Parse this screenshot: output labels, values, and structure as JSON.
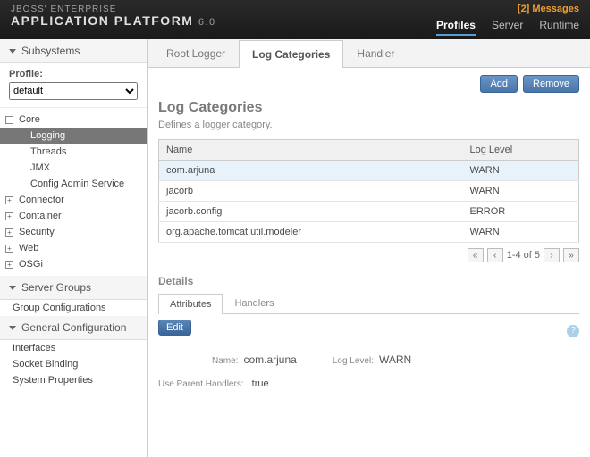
{
  "header": {
    "messages": "[2] Messages",
    "brand_top": "JBOSS' ENTERPRISE",
    "brand_main": "APPLICATION PLATFORM",
    "brand_version": "6.0",
    "nav": {
      "profiles": "Profiles",
      "server": "Server",
      "runtime": "Runtime"
    }
  },
  "sidebar": {
    "subsystems_label": "Subsystems",
    "profile_label": "Profile:",
    "profile_value": "default",
    "core": {
      "label": "Core",
      "logging": "Logging",
      "threads": "Threads",
      "jmx": "JMX",
      "config_admin": "Config Admin Service"
    },
    "connector": "Connector",
    "container": "Container",
    "security": "Security",
    "web": "Web",
    "osgi": "OSGi",
    "server_groups_label": "Server Groups",
    "group_configurations": "Group Configurations",
    "general_config_label": "General Configuration",
    "interfaces": "Interfaces",
    "socket_binding": "Socket Binding",
    "system_properties": "System Properties"
  },
  "main": {
    "tabs": {
      "root_logger": "Root Logger",
      "log_categories": "Log Categories",
      "handler": "Handler"
    },
    "buttons": {
      "add": "Add",
      "remove": "Remove",
      "edit": "Edit"
    },
    "title": "Log Categories",
    "description": "Defines a logger category.",
    "table": {
      "col_name": "Name",
      "col_level": "Log Level",
      "rows": [
        {
          "name": "com.arjuna",
          "level": "WARN"
        },
        {
          "name": "jacorb",
          "level": "WARN"
        },
        {
          "name": "jacorb.config",
          "level": "ERROR"
        },
        {
          "name": "org.apache.tomcat.util.modeler",
          "level": "WARN"
        }
      ]
    },
    "pager": {
      "text": "1-4 of 5"
    },
    "details": {
      "heading": "Details",
      "subtabs": {
        "attributes": "Attributes",
        "handlers": "Handlers"
      },
      "labels": {
        "name": "Name:",
        "log_level": "Log Level:",
        "use_parent": "Use Parent Handlers:"
      },
      "values": {
        "name": "com.arjuna",
        "log_level": "WARN",
        "use_parent": "true"
      }
    }
  }
}
